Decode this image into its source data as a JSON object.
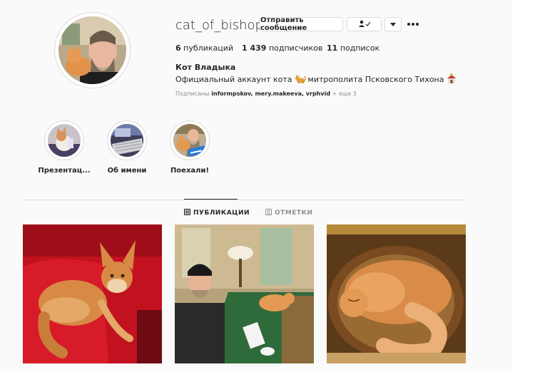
{
  "profile": {
    "username": "cat_of_bishop",
    "full_name": "Кот Владыка",
    "bio_part1": "Официальный аккаунт кота",
    "bio_part2": "митрополита Псковского Тихона",
    "followed_by_prefix": "Подписаны",
    "followed_by_names": "informpskov, mery.makeeva, vrphvid",
    "followed_by_more": "+ еще 3"
  },
  "actions": {
    "message_label": "Отправить сообщение"
  },
  "stats": {
    "posts_count": "6",
    "posts_label": "публикаций",
    "followers_count": "1 439",
    "followers_label": "подписчиков",
    "following_count": "11",
    "following_label": "подписок"
  },
  "highlights": [
    {
      "label": "Презентац..."
    },
    {
      "label": "Об имени"
    },
    {
      "label": "Поехали!"
    }
  ],
  "tabs": {
    "posts_label": "ПУБЛИКАЦИИ",
    "tagged_label": "ОТМЕТКИ"
  },
  "colors": {
    "text": "#262626",
    "secondary": "#8e8e8e",
    "border": "#dbdbdb",
    "background": "#fafafa"
  },
  "icons": [
    "person-check-icon",
    "chevron-down-icon",
    "more-icon",
    "grid-icon",
    "tag-icon",
    "cat-emoji-icon",
    "church-emoji-icon"
  ]
}
